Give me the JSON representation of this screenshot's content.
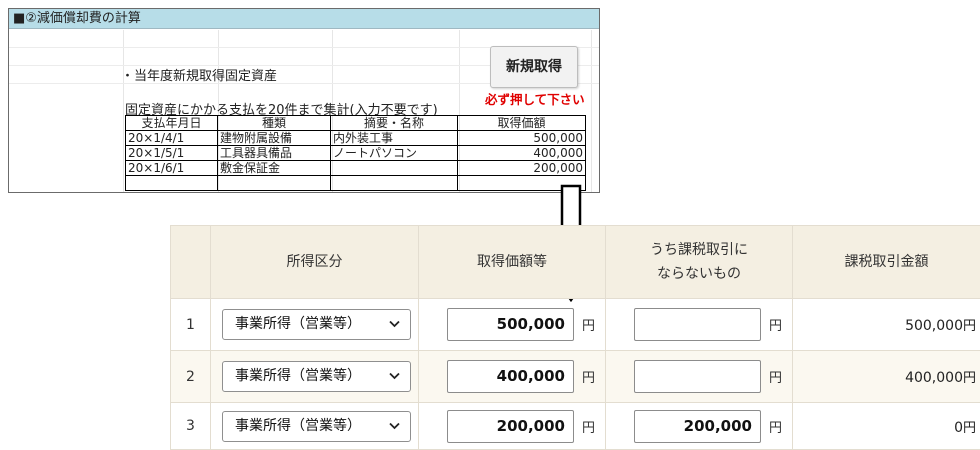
{
  "sheet": {
    "title": "■②減価償却費の計算",
    "assets_label": "・当年度新規取得固定資産",
    "new_button": "新規取得",
    "must_press": "必ず押して下さい",
    "aggregate_note": "固定資産にかかる支払を20件まで集計(入力不要です)",
    "table_headers": [
      "支払年月日",
      "種類",
      "摘要・名称",
      "取得価額"
    ],
    "rows": [
      {
        "date": "20×1/4/1",
        "type": "建物附属設備",
        "summary": "内外装工事",
        "amount": "500,000"
      },
      {
        "date": "20×1/5/1",
        "type": "工具器具備品",
        "summary": "ノートパソコン",
        "amount": "400,000"
      },
      {
        "date": "20×1/6/1",
        "type": "敷金保証金",
        "summary": "",
        "amount": "200,000"
      }
    ]
  },
  "form": {
    "headers": {
      "no": "",
      "category": "所得区分",
      "acq": "取得価額等",
      "nontax_line1": "うち課税取引に",
      "nontax_line2": "ならないもの",
      "taxable": "課税取引金額"
    },
    "yen": "円",
    "rows": [
      {
        "no": "1",
        "category": "事業所得（営業等）",
        "acq": "500,000",
        "nontax": "",
        "taxable": "500,000"
      },
      {
        "no": "2",
        "category": "事業所得（営業等）",
        "acq": "400,000",
        "nontax": "",
        "taxable": "400,000"
      },
      {
        "no": "3",
        "category": "事業所得（営業等）",
        "acq": "200,000",
        "nontax": "200,000",
        "taxable": "0"
      }
    ]
  },
  "icons": {
    "arrow": "down-arrow-icon",
    "chevron": "chevron-down-icon"
  }
}
